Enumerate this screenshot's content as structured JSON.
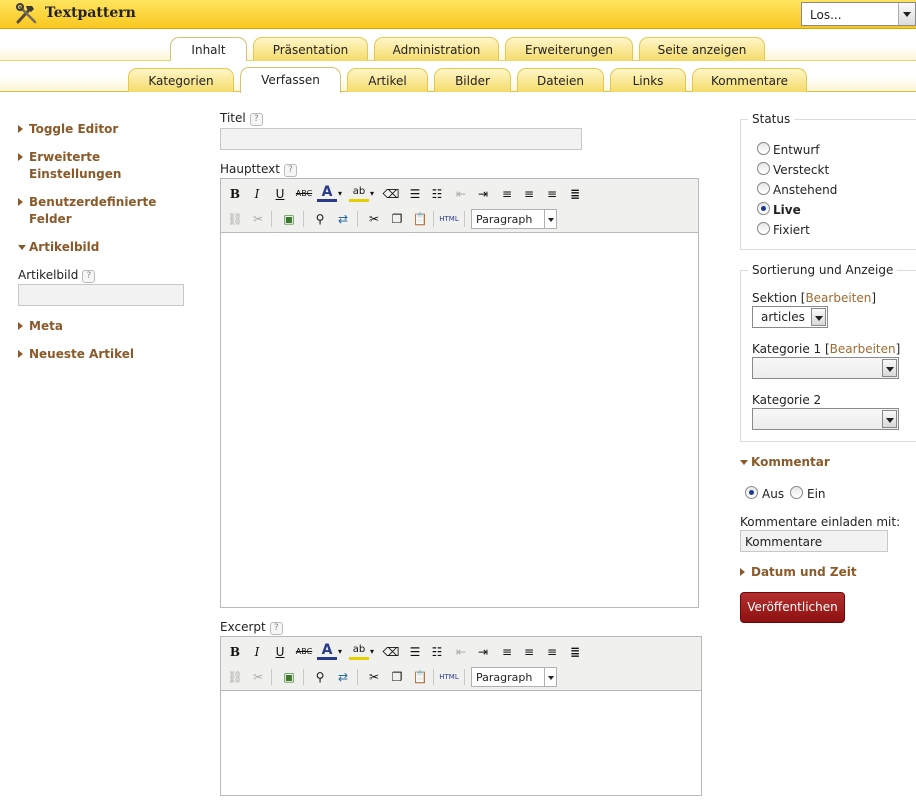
{
  "app": {
    "title": "Textpattern"
  },
  "header": {
    "logout_select": "Los..."
  },
  "tabs_main": [
    "Inhalt",
    "Präsentation",
    "Administration",
    "Erweiterungen",
    "Seite anzeigen"
  ],
  "tabs_sub": [
    "Kategorien",
    "Verfassen",
    "Artikel",
    "Bilder",
    "Dateien",
    "Links",
    "Kommentare"
  ],
  "left": {
    "toggle_editor": "Toggle Editor",
    "advanced": "Erweiterte Einstellungen",
    "custom_fields": "Benutzerdefinierte Felder",
    "article_image_heading": "Artikelbild",
    "article_image_label": "Artikelbild",
    "article_image_value": "",
    "meta": "Meta",
    "recent": "Neueste Artikel"
  },
  "main": {
    "title_label": "Titel",
    "title_value": "",
    "body_label": "Haupttext",
    "excerpt_label": "Excerpt",
    "help_glyph": "?",
    "paragraph": "Paragraph"
  },
  "toolbar": {
    "bold": "B",
    "italic": "I",
    "underline": "U",
    "strike": "ABC",
    "forecolor": "A",
    "backcolor": "ab",
    "html": "HTML"
  },
  "status": {
    "legend": "Status",
    "options": [
      "Entwurf",
      "Versteckt",
      "Anstehend",
      "Live",
      "Fixiert"
    ],
    "selected": "Live"
  },
  "sort": {
    "legend": "Sortierung und Anzeige",
    "section_label": "Sektion",
    "edit": "Bearbeiten",
    "section_value": "articles",
    "category1_label": "Kategorie 1",
    "category2_label": "Kategorie 2"
  },
  "comments": {
    "heading": "Kommentar",
    "off": "Aus",
    "on": "Ein",
    "selected": "Aus",
    "invite_label": "Kommentare einladen mit:",
    "invite_value": "Kommentare"
  },
  "datetime": {
    "heading": "Datum und Zeit"
  },
  "actions": {
    "publish": "Veröffentlichen"
  }
}
